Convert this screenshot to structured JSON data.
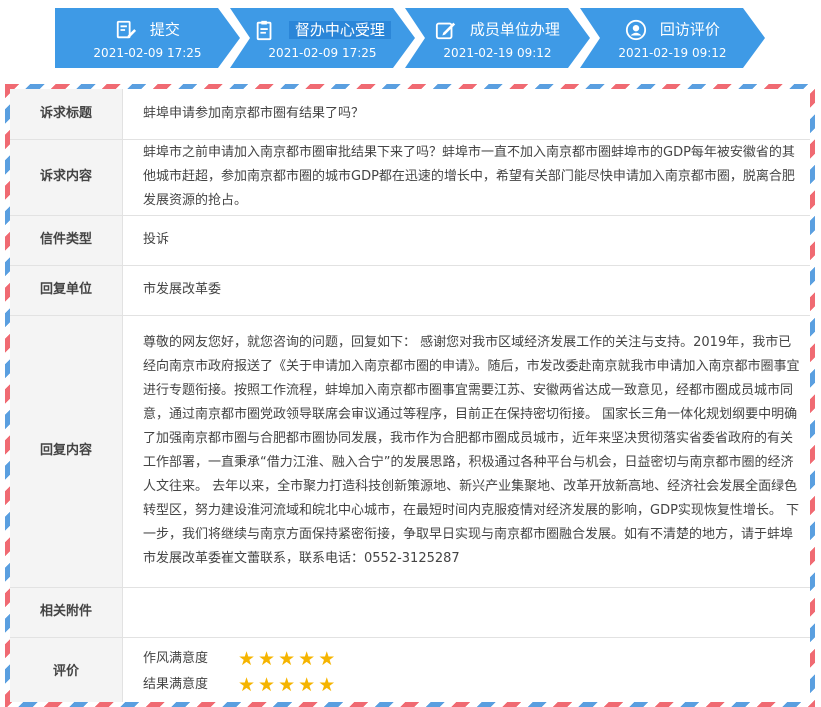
{
  "steps": [
    {
      "label": "提交",
      "date": "2021-02-09 17:25",
      "icon": "edit-doc-icon"
    },
    {
      "label": "督办中心受理",
      "date": "2021-02-09 17:25",
      "icon": "clipboard-icon"
    },
    {
      "label": "成员单位办理",
      "date": "2021-02-19 09:12",
      "icon": "pen-square-icon"
    },
    {
      "label": "回访评价",
      "date": "2021-02-19 09:12",
      "icon": "user-circle-icon"
    }
  ],
  "colors": {
    "step_bg": "#3e9ae6",
    "star": "#f5b400",
    "label_bg": "#f4f4f4"
  },
  "detail": {
    "subject_label": "诉求标题",
    "subject": "蚌埠申请参加南京都市圈有结果了吗？",
    "content_label": "诉求内容",
    "content": "蚌埠市之前申请加入南京都市圈审批结果下来了吗？蚌埠市一直不加入南京都市圈蚌埠市的GDP每年被安徽省的其他城市赶超，参加南京都市圈的城市GDP都在迅速的增长中，希望有关部门能尽快申请加入南京都市圈，脱离合肥发展资源的抢占。",
    "type_label": "信件类型",
    "type": "投诉",
    "unit_label": "回复单位",
    "unit": "市发展改革委",
    "reply_label": "回复内容",
    "reply": "尊敬的网友您好，就您咨询的问题，回复如下： 感谢您对我市区域经济发展工作的关注与支持。2019年，我市已经向南京市政府报送了《关于申请加入南京都市圈的申请》。随后，市发改委赴南京就我市申请加入南京都市圈事宜进行专题衔接。按照工作流程，蚌埠加入南京都市圈事宜需要江苏、安徽两省达成一致意见，经都市圈成员城市同意，通过南京都市圈党政领导联席会审议通过等程序，目前正在保持密切衔接。 国家长三角一体化规划纲要中明确了加强南京都市圈与合肥都市圈协同发展，我市作为合肥都市圈成员城市，近年来坚决贯彻落实省委省政府的有关工作部署，一直秉承“借力江淮、融入合宁”的发展思路，积极通过各种平台与机会，日益密切与南京都市圈的经济人文往来。 去年以来，全市聚力打造科技创新策源地、新兴产业集聚地、改革开放新高地、经济社会发展全面绿色转型区，努力建设淮河流域和皖北中心城市，在最短时间内克服疫情对经济发展的影响，GDP实现恢复性增长。 下一步，我们将继续与南京方面保持紧密衔接，争取早日实现与南京都市圈融合发展。如有不清楚的地方，请于蚌埠市发展改革委崔文蕾联系，联系电话：0552-3125287",
    "attach_label": "相关附件",
    "rating_label": "评价",
    "ratings": [
      {
        "label": "作风满意度",
        "stars": 5
      },
      {
        "label": "结果满意度",
        "stars": 5
      }
    ]
  }
}
